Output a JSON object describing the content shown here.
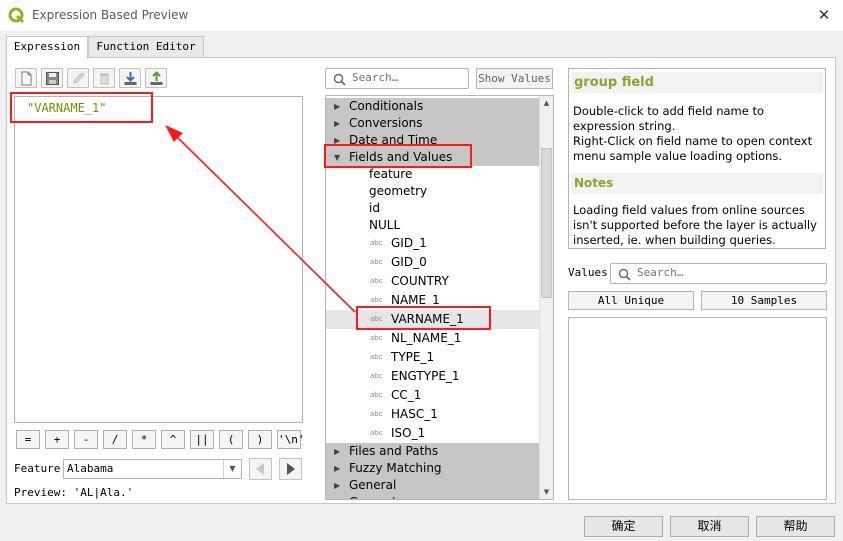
{
  "window": {
    "title": "Expression Based Preview",
    "close": "✕"
  },
  "tabs": [
    {
      "label": "Expression"
    },
    {
      "label": "Function Editor"
    }
  ],
  "toolbar_icons": [
    "new-file-icon",
    "save-icon",
    "edit-icon",
    "delete-icon",
    "import-icon",
    "export-icon"
  ],
  "editor": {
    "code": "\"VARNAME_1\""
  },
  "operators": [
    "=",
    "+",
    "-",
    "/",
    "*",
    "^",
    "||",
    "(",
    ")",
    "'\\n'"
  ],
  "feature": {
    "label": "Feature",
    "value": "Alabama"
  },
  "preview": {
    "text": "Preview: 'AL|Ala.'"
  },
  "search": {
    "placeholder": "Search…",
    "show_values": "Show Values"
  },
  "tree": {
    "rows": [
      {
        "label": "Conditionals",
        "kind": "group"
      },
      {
        "label": "Conversions",
        "kind": "group"
      },
      {
        "label": "Date and Time",
        "kind": "group"
      },
      {
        "label": "Fields and Values",
        "kind": "group-open"
      },
      {
        "label": "feature",
        "kind": "item"
      },
      {
        "label": "geometry",
        "kind": "item"
      },
      {
        "label": "id",
        "kind": "item"
      },
      {
        "label": "NULL",
        "kind": "item"
      },
      {
        "label": "GID_1",
        "kind": "field",
        "tag": "abc"
      },
      {
        "label": "GID_0",
        "kind": "field",
        "tag": "abc"
      },
      {
        "label": "COUNTRY",
        "kind": "field",
        "tag": "abc"
      },
      {
        "label": "NAME_1",
        "kind": "field",
        "tag": "abc"
      },
      {
        "label": "VARNAME_1",
        "kind": "field-selected",
        "tag": "abc"
      },
      {
        "label": "NL_NAME_1",
        "kind": "field",
        "tag": "abc"
      },
      {
        "label": "TYPE_1",
        "kind": "field",
        "tag": "abc"
      },
      {
        "label": "ENGTYPE_1",
        "kind": "field",
        "tag": "abc"
      },
      {
        "label": "CC_1",
        "kind": "field",
        "tag": "abc"
      },
      {
        "label": "HASC_1",
        "kind": "field",
        "tag": "abc"
      },
      {
        "label": "ISO_1",
        "kind": "field",
        "tag": "abc"
      },
      {
        "label": "Files and Paths",
        "kind": "group"
      },
      {
        "label": "Fuzzy Matching",
        "kind": "group"
      },
      {
        "label": "General",
        "kind": "group"
      },
      {
        "label": "Geometry",
        "kind": "group"
      }
    ]
  },
  "help": {
    "title": "group field",
    "description": "Double-click to add field name to expression string.",
    "description2": "Right-Click on field name to open context menu sample value loading options.",
    "notes_title": "Notes",
    "notes": "Loading field values from online sources isn't supported before the layer is actually inserted, ie. when building queries."
  },
  "values": {
    "label": "Values",
    "placeholder": "Search…",
    "all_unique": "All Unique",
    "ten_samples": "10 Samples"
  },
  "buttons": {
    "ok": "确定",
    "cancel": "取消",
    "help": "帮助"
  },
  "colors": {
    "annotation": "#ff1a1a",
    "help_heading": "#8aa630",
    "code": "#6f8f00",
    "qgis_green": "#93b023"
  }
}
